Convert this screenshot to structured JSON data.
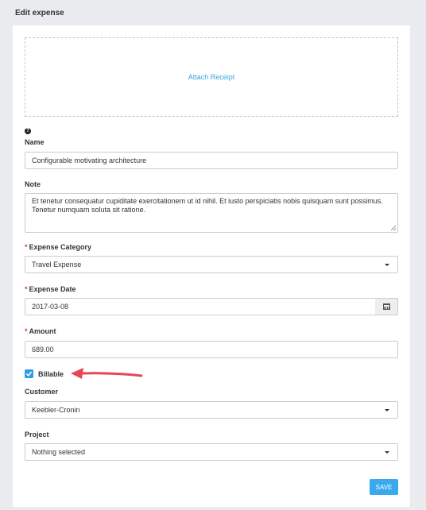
{
  "page": {
    "title": "Edit expense"
  },
  "receipt": {
    "link_label": "Attach Receipt"
  },
  "form": {
    "name": {
      "label": "Name",
      "value": "Configurable motivating architecture"
    },
    "note": {
      "label": "Note",
      "value": "Et tenetur consequatur cupiditate exercitationem ut id nihil. Et iusto perspiciatis nobis quisquam sunt possimus. Tenetur numquam soluta sit ratione."
    },
    "expense_category": {
      "label": "Expense Category",
      "required_mark": "*",
      "selected": "Travel Expense"
    },
    "expense_date": {
      "label": "Expense Date",
      "required_mark": "*",
      "value": "2017-03-08"
    },
    "amount": {
      "label": "Amount",
      "required_mark": "*",
      "value": "689.00"
    },
    "billable": {
      "label": "Billable",
      "checked": true
    },
    "customer": {
      "label": "Customer",
      "selected": "Keebler-Cronin"
    },
    "project": {
      "label": "Project",
      "selected": "Nothing selected"
    },
    "save_label": "SAVE"
  },
  "icons": {
    "help": "question-circle-icon",
    "calendar": "calendar-icon",
    "caret": "caret-down-icon",
    "check": "checkmark-icon",
    "annotation_arrow": "arrow-left-icon"
  },
  "colors": {
    "accent": "#3aa9ee",
    "link": "#3aa3e3",
    "required": "#e53935",
    "annotation_arrow": "#e8455a",
    "background": "#e9ebee"
  }
}
